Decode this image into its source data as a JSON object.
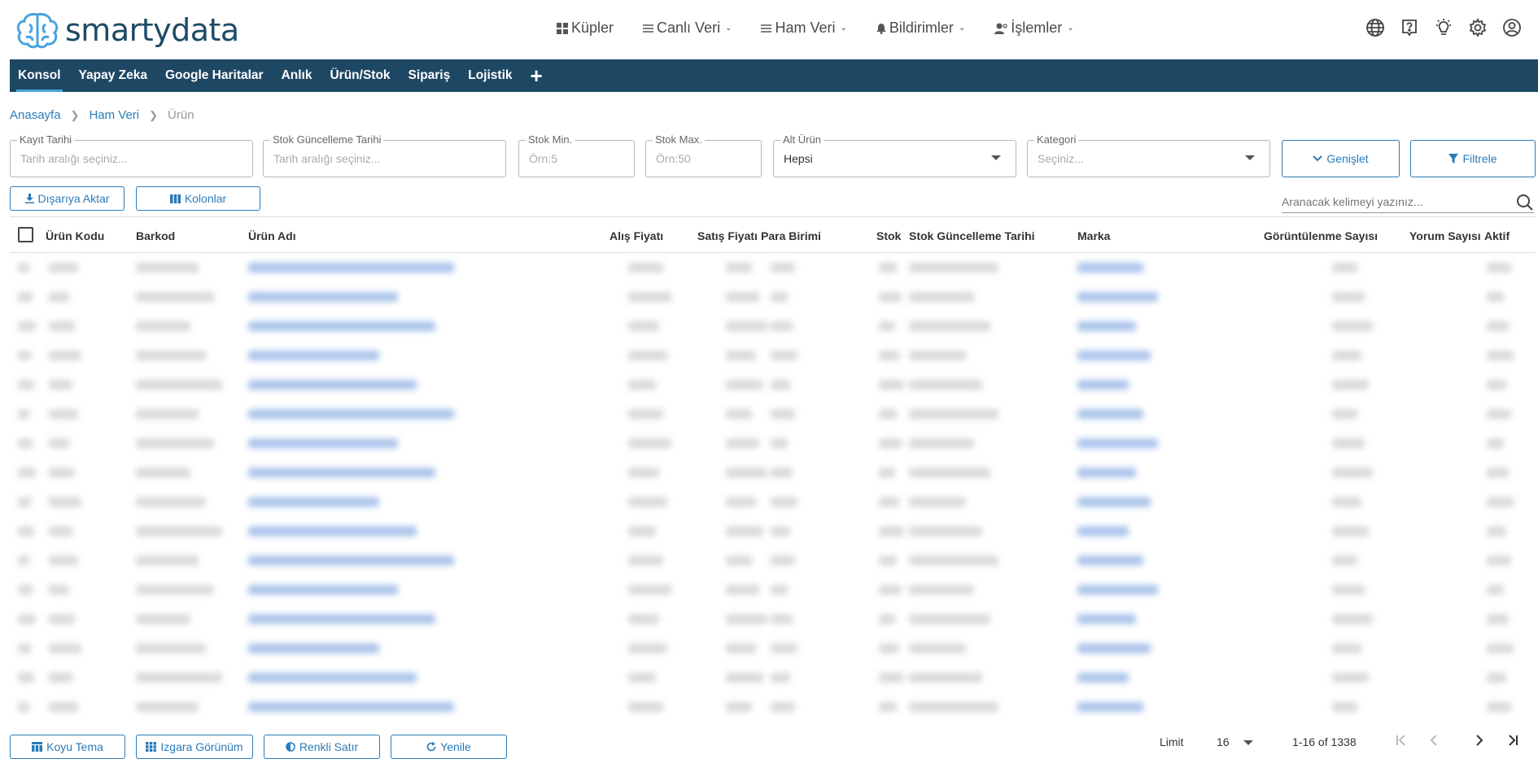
{
  "brand": {
    "prefix": "smarty",
    "suffix": "data"
  },
  "topnav": [
    {
      "label": "Küpler",
      "has_menu": false
    },
    {
      "label": "Canlı Veri",
      "has_menu": true
    },
    {
      "label": "Ham Veri",
      "has_menu": true
    },
    {
      "label": "Bildirimler",
      "has_menu": true
    },
    {
      "label": "İşlemler",
      "has_menu": true
    }
  ],
  "top_icons": [
    "globe-icon",
    "help-icon",
    "theme-bulb-icon",
    "settings-gear-icon",
    "user-account-icon"
  ],
  "tabs": [
    {
      "label": "Konsol",
      "active": true
    },
    {
      "label": "Yapay Zeka",
      "active": false
    },
    {
      "label": "Google Haritalar",
      "active": false
    },
    {
      "label": "Anlık",
      "active": false
    },
    {
      "label": "Ürün/Stok",
      "active": false
    },
    {
      "label": "Sipariş",
      "active": false
    },
    {
      "label": "Lojistik",
      "active": false
    }
  ],
  "tab_add": "+",
  "breadcrumb": {
    "home": "Anasayfa",
    "section": "Ham Veri",
    "current": "Ürün"
  },
  "filters": {
    "kayit_tarihi": {
      "label": "Kayıt Tarihi",
      "placeholder": "Tarih aralığı seçiniz..."
    },
    "stok_guncelleme": {
      "label": "Stok Güncelleme Tarihi",
      "placeholder": "Tarih aralığı seçiniz..."
    },
    "stok_min": {
      "label": "Stok Min.",
      "placeholder": "Örn:5"
    },
    "stok_max": {
      "label": "Stok Max.",
      "placeholder": "Örn:50"
    },
    "alt_urun": {
      "label": "Alt Ürün",
      "value": "Hepsi"
    },
    "kategori": {
      "label": "Kategori",
      "placeholder": "Seçiniz..."
    }
  },
  "buttons": {
    "genislet": "Genişlet",
    "filtrele": "Filtrele",
    "export": "Dışarıya Aktar",
    "columns": "Kolonlar",
    "dark_theme": "Koyu Tema",
    "grid_view": "Izgara Görünüm",
    "colored_rows": "Renkli Satır",
    "refresh": "Yenile"
  },
  "search": {
    "placeholder": "Aranacak kelimeyi yazınız..."
  },
  "columns": [
    "Ürün Kodu",
    "Barkod",
    "Ürün Adı",
    "Alış Fiyatı",
    "Satış Fiyatı",
    "Para Birimi",
    "Stok",
    "Stok Güncelleme Tarihi",
    "Marka",
    "Görüntülenme Sayısı",
    "Yorum Sayısı",
    "Aktif"
  ],
  "pagination": {
    "limit_label": "Limit",
    "limit_value": "16",
    "range": "1-16 of 1338"
  },
  "colors": {
    "primary": "#2b7bb9",
    "tabbar": "#1e4763",
    "link": "#2b7bb9"
  }
}
